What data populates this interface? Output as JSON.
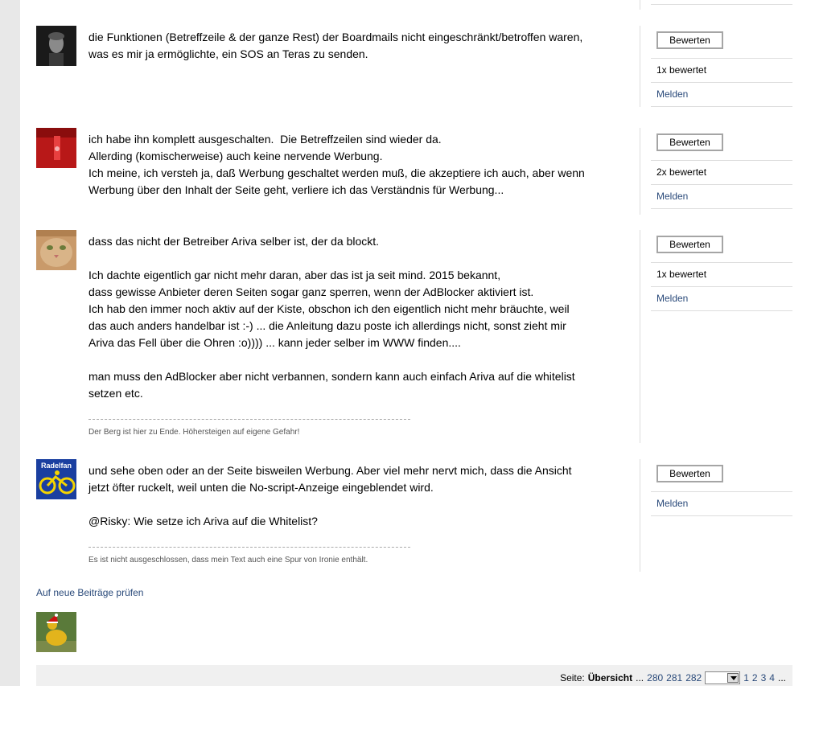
{
  "posts": [
    {
      "avatar": "portrait-avatar",
      "lines": [
        "die Funktionen (Betreffzeile & der ganze Rest) der Boardmails nicht eingeschränkt/betroffen waren,",
        "was es mir ja ermöglichte, ein SOS an Teras zu senden."
      ],
      "rate_label": "Bewerten",
      "rating_count": "1x bewertet",
      "report_label": "Melden"
    },
    {
      "avatar": "red-avatar",
      "lines": [
        "ich habe ihn komplett ausgeschalten.  Die Betreffzeilen sind wieder da.",
        "Allerding (komischerweise) auch keine nervende Werbung.",
        "Ich meine, ich versteh ja, daß Werbung geschaltet werden muß, die akzeptiere ich auch, aber wenn",
        "Werbung über den Inhalt der Seite geht, verliere ich das Verständnis für Werbung..."
      ],
      "rate_label": "Bewerten",
      "rating_count": "2x bewertet",
      "report_label": "Melden"
    },
    {
      "avatar": "cat-avatar",
      "lines": [
        "dass das nicht der Betreiber Ariva selber ist, der da blockt.",
        "",
        "Ich dachte eigentlich gar nicht mehr daran, aber das ist ja seit mind. 2015 bekannt,",
        "dass gewisse Anbieter deren Seiten sogar ganz sperren, wenn der AdBlocker aktiviert ist.",
        "Ich hab den immer noch aktiv auf der Kiste, obschon ich den eigentlich nicht mehr bräuchte, weil",
        "das auch anders handelbar ist :-) ... die Anleitung dazu poste ich allerdings nicht, sonst zieht mir",
        "Ariva das Fell über die Ohren :o)))) ... kann jeder selber im WWW finden....",
        "",
        "man muss den AdBlocker aber nicht verbannen, sondern kann auch einfach Ariva auf die whitelist",
        "setzen etc."
      ],
      "signature": "Der Berg ist hier zu Ende. Höhersteigen auf eigene Gefahr!",
      "rate_label": "Bewerten",
      "rating_count": "1x bewertet",
      "report_label": "Melden"
    },
    {
      "avatar": "radelfan-avatar",
      "avatar_text": "Radelfan",
      "lines": [
        "und sehe oben oder an der Seite bisweilen Werbung. Aber viel mehr nervt mich, dass die Ansicht",
        "jetzt öfter ruckelt, weil unten die No-script-Anzeige eingeblendet wird.",
        "",
        "@Risky: Wie setze ich Ariva auf die Whitelist?"
      ],
      "signature": "Es ist nicht ausgeschlossen, dass mein Text auch eine Spur von Ironie enthält.",
      "rate_label": "Bewerten",
      "report_label": "Melden"
    }
  ],
  "check_new_posts": "Auf neue Beiträge prüfen",
  "pager": {
    "label": "Seite:",
    "overview": "Übersicht",
    "ellipsis": "...",
    "pages_before": [
      "280",
      "281",
      "282"
    ],
    "select_value": "",
    "pages_after": [
      "1",
      "2",
      "3",
      "4"
    ],
    "trailing": "..."
  },
  "colors": {
    "link": "#2a4a7a",
    "divider": "#dddddd",
    "sidebar_bg": "#e8e8e8",
    "pager_bg": "#f0f0f0"
  }
}
